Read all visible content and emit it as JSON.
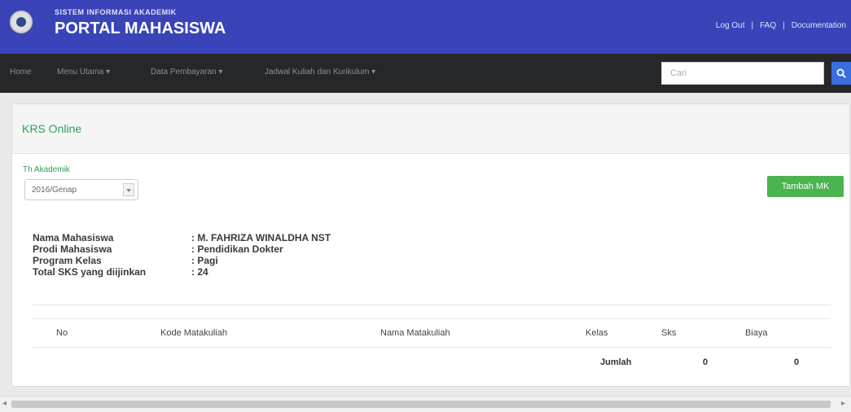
{
  "header": {
    "subtitle": "SISTEM INFORMASI AKADEMIK",
    "title": "PORTAL MAHASISWA",
    "links": [
      "Log Out",
      "FAQ",
      "Documentation"
    ]
  },
  "nav": {
    "items": [
      "Home",
      "Menu Utama",
      "Data Pembayaran",
      "Jadwal Kuliah dan Kurikulum"
    ],
    "search_placeholder": "Cari"
  },
  "panel": {
    "title": "KRS Online",
    "academic_year_label": "Th Akademik",
    "academic_year_value": "2016/Genap",
    "add_button": "Tambah MK"
  },
  "student": [
    {
      "label": "Nama Mahasiswa",
      "value": ": M. FAHRIZA WINALDHA NST"
    },
    {
      "label": "Prodi Mahasiswa",
      "value": ": Pendidikan Dokter"
    },
    {
      "label": "Program Kelas",
      "value": ": Pagi"
    },
    {
      "label": "Total SKS yang diijinkan",
      "value": ": 24"
    }
  ],
  "table": {
    "headers": [
      "No",
      "Kode Matakuliah",
      "Nama Matakuliah",
      "Kelas",
      "Sks",
      "Biaya"
    ],
    "summary": {
      "label": "Jumlah",
      "sks": "0",
      "biaya": "0"
    }
  },
  "colors": {
    "header_bg": "#3a44b8",
    "nav_bg": "#252729",
    "accent_green": "#4bb34f",
    "title_green": "#2e9e56",
    "search_button": "#3a6ee0"
  },
  "icons": {
    "logo": "university-seal-icon",
    "search": "magnifier-icon"
  }
}
